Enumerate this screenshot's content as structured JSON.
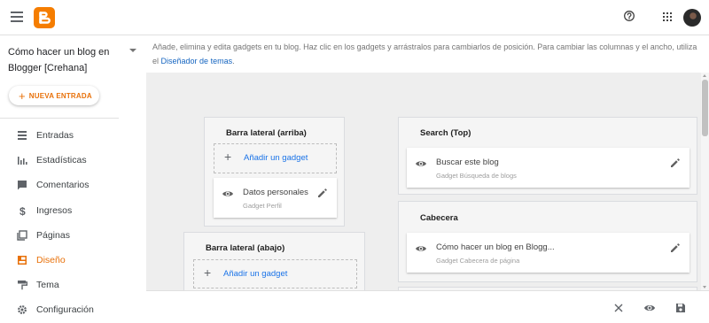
{
  "topbar": {
    "menu_icon": "hamburger-menu-icon",
    "logo_icon": "blogger-logo-icon",
    "help_icon": "help-icon",
    "apps_icon": "apps-grid-icon",
    "avatar_icon": "user-avatar"
  },
  "sidebar": {
    "blog_name": "Cómo hacer un blog en Blogger [Crehana]",
    "new_post_label": "NUEVA ENTRADA",
    "items": [
      {
        "label": "Entradas",
        "icon": "posts-icon"
      },
      {
        "label": "Estadísticas",
        "icon": "stats-icon"
      },
      {
        "label": "Comentarios",
        "icon": "comments-icon"
      },
      {
        "label": "Ingresos",
        "icon": "dollar-icon"
      },
      {
        "label": "Páginas",
        "icon": "pages-icon"
      },
      {
        "label": "Diseño",
        "icon": "layout-icon",
        "active": true
      },
      {
        "label": "Tema",
        "icon": "paint-roller-icon"
      },
      {
        "label": "Configuración",
        "icon": "gear-icon"
      }
    ]
  },
  "main": {
    "help_text": "Añade, elimina y edita gadgets en tu blog. Haz clic en los gadgets y arrástralos para cambiarlos de posición. Para cambiar las columnas y el ancho, utiliza el",
    "help_link": "Diseñador de temas",
    "help_end": ".",
    "sections": {
      "sidebar_top": {
        "title": "Barra lateral (arriba)",
        "add_label": "Añadir un gadget",
        "gadget": {
          "name": "Datos personales",
          "type": "Gadget Perfil"
        }
      },
      "sidebar_bottom": {
        "title": "Barra lateral (abajo)",
        "add_label": "Añadir un gadget"
      },
      "search_top": {
        "title": "Search (Top)",
        "gadget": {
          "name": "Buscar este blog",
          "type": "Gadget Búsqueda de blogs"
        }
      },
      "header": {
        "title": "Cabecera",
        "gadget": {
          "name": "Cómo hacer un blog en Blogg...",
          "type": "Gadget Cabecera de página"
        }
      }
    },
    "actions": {
      "close_icon": "close-icon",
      "preview_icon": "preview-eye-icon",
      "save_icon": "save-icon"
    }
  },
  "colors": {
    "accent": "#e8710a",
    "logo": "#f57d00",
    "link": "#1565c0",
    "canvas_bg": "#eeeeee"
  }
}
